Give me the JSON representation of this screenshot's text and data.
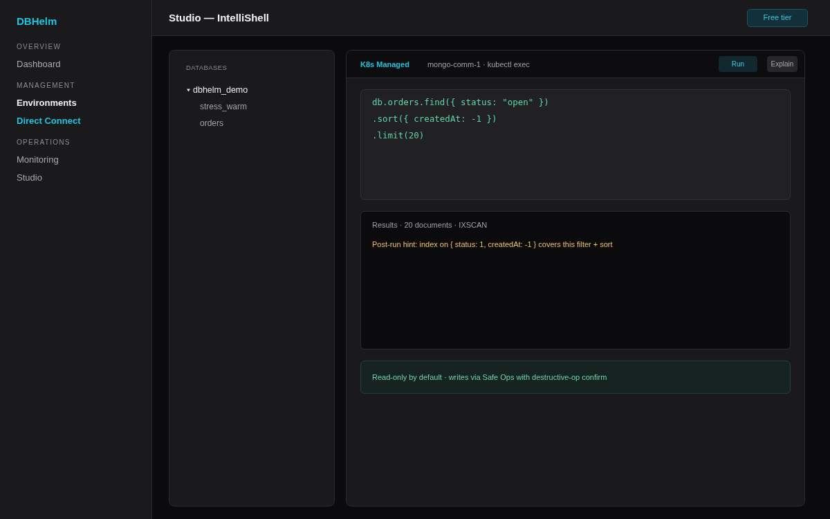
{
  "sidebar": {
    "brand": "DBHelm",
    "sections": [
      {
        "heading": "OVERVIEW",
        "items": [
          {
            "label": "Dashboard",
            "selected": false,
            "emphasized": false
          }
        ]
      },
      {
        "heading": "MANAGEMENT",
        "items": [
          {
            "label": "Environments",
            "selected": false,
            "emphasized": true
          },
          {
            "label": "Direct Connect",
            "selected": true,
            "emphasized": false
          }
        ]
      },
      {
        "heading": "OPERATIONS",
        "items": [
          {
            "label": "Monitoring",
            "selected": false,
            "emphasized": false
          },
          {
            "label": "Studio",
            "selected": false,
            "emphasized": false
          }
        ]
      }
    ]
  },
  "header": {
    "title": "Studio — IntelliShell",
    "plan_button": "Free tier"
  },
  "database_tree": {
    "heading": "DATABASES",
    "nodes": [
      {
        "label": "dbhelm_demo",
        "expanded": true,
        "children": [
          {
            "label": "stress_warm"
          },
          {
            "label": "orders"
          }
        ]
      }
    ]
  },
  "shell": {
    "mode": "K8s Managed",
    "target": "mongo-comm-1 · kubectl exec",
    "buttons": [
      {
        "label": "Run",
        "kind": "primary"
      },
      {
        "label": "Explain",
        "kind": "secondary"
      }
    ],
    "query_lines": [
      "db.orders.find({ status: \"open\" })",
      ".sort({ createdAt: -1 })",
      ".limit(20)"
    ],
    "results": {
      "summary": "Results · 20 documents · IXSCAN",
      "hint": "Post-run hint: index on { status: 1, createdAt: -1 } covers this filter + sort"
    },
    "notice": "Read-only by default · writes via Safe Ops with destructive-op confirm"
  }
}
